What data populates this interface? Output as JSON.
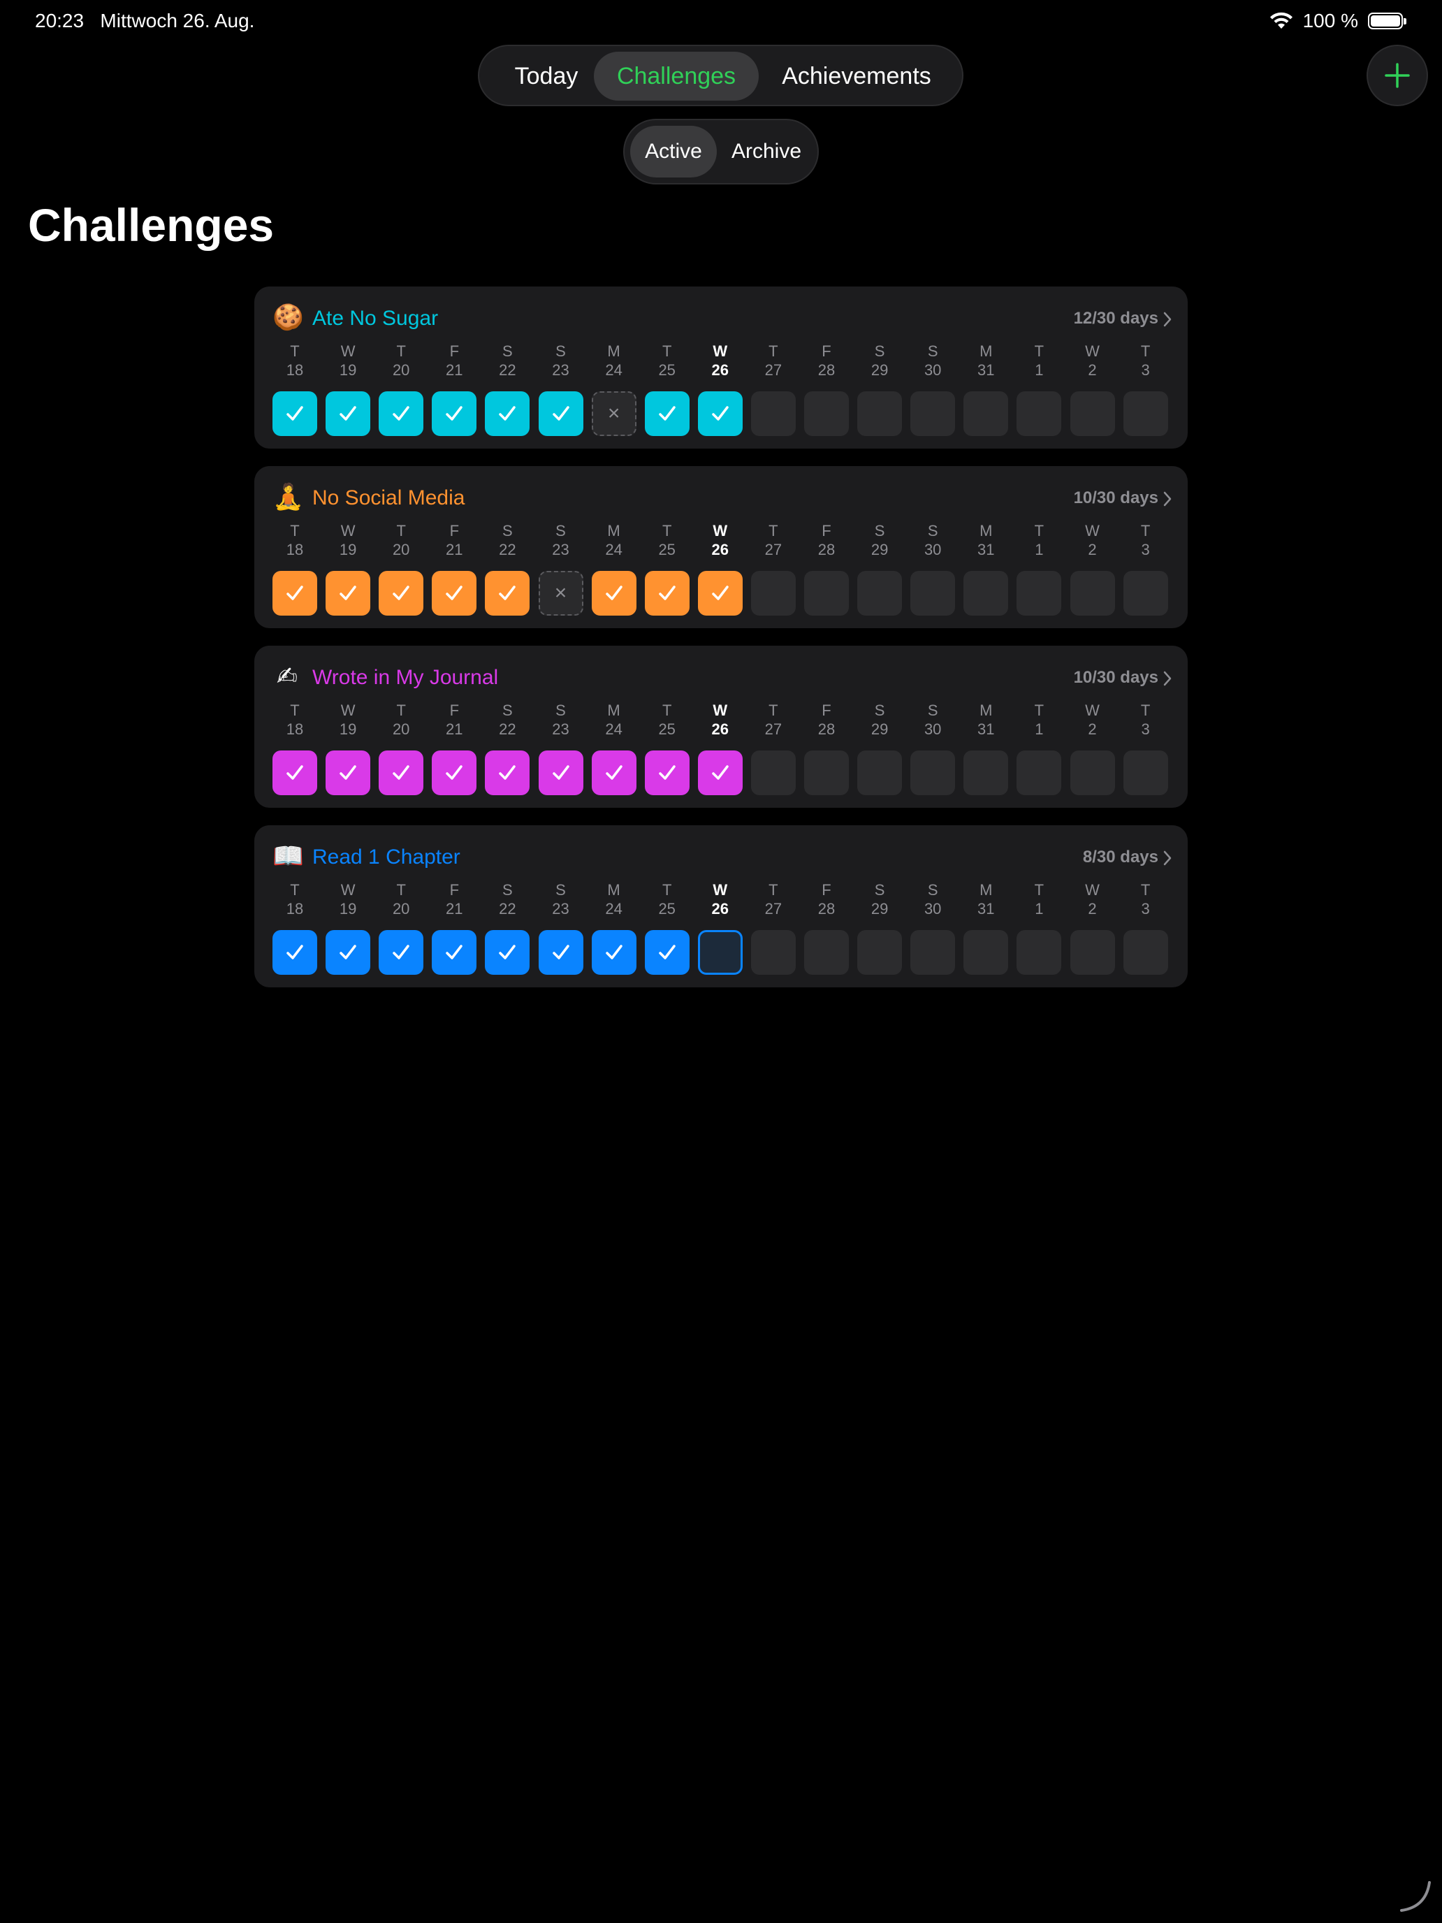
{
  "status": {
    "time": "20:23",
    "date": "Mittwoch 26. Aug.",
    "battery": "100 %"
  },
  "tabs": {
    "today": "Today",
    "challenges": "Challenges",
    "achievements": "Achievements",
    "selected": "Challenges"
  },
  "filter": {
    "active": "Active",
    "archive": "Archive",
    "selected": "Active"
  },
  "page_title": "Challenges",
  "colors": {
    "accent": "#30d158",
    "cyan": "#00c7de",
    "orange": "#ff9230",
    "magenta": "#d93ae8",
    "blue": "#0a84ff"
  },
  "days": [
    {
      "letter": "T",
      "num": "18"
    },
    {
      "letter": "W",
      "num": "19"
    },
    {
      "letter": "T",
      "num": "20"
    },
    {
      "letter": "F",
      "num": "21"
    },
    {
      "letter": "S",
      "num": "22"
    },
    {
      "letter": "S",
      "num": "23"
    },
    {
      "letter": "M",
      "num": "24"
    },
    {
      "letter": "T",
      "num": "25"
    },
    {
      "letter": "W",
      "num": "26"
    },
    {
      "letter": "T",
      "num": "27"
    },
    {
      "letter": "F",
      "num": "28"
    },
    {
      "letter": "S",
      "num": "29"
    },
    {
      "letter": "S",
      "num": "30"
    },
    {
      "letter": "M",
      "num": "31"
    },
    {
      "letter": "T",
      "num": "1"
    },
    {
      "letter": "W",
      "num": "2"
    },
    {
      "letter": "T",
      "num": "3"
    }
  ],
  "today_index": 8,
  "challenges": [
    {
      "emoji": "🍪",
      "emoji_name": "cookie-icon",
      "title": "Ate No Sugar",
      "progress": "12/30 days",
      "color": "#00c7de",
      "states": [
        "done",
        "done",
        "done",
        "done",
        "done",
        "done",
        "missed",
        "done",
        "done",
        "future",
        "future",
        "future",
        "future",
        "future",
        "future",
        "future",
        "future"
      ]
    },
    {
      "emoji": "🧘",
      "emoji_name": "meditation-icon",
      "title": "No Social Media",
      "progress": "10/30 days",
      "color": "#ff9230",
      "states": [
        "done",
        "done",
        "done",
        "done",
        "done",
        "missed",
        "done",
        "done",
        "done",
        "future",
        "future",
        "future",
        "future",
        "future",
        "future",
        "future",
        "future"
      ]
    },
    {
      "emoji": "✍",
      "emoji_name": "writing-hand-icon",
      "title": "Wrote in My Journal",
      "progress": "10/30 days",
      "color": "#d93ae8",
      "states": [
        "done",
        "done",
        "done",
        "done",
        "done",
        "done",
        "done",
        "done",
        "done",
        "future",
        "future",
        "future",
        "future",
        "future",
        "future",
        "future",
        "future"
      ]
    },
    {
      "emoji": "📖",
      "emoji_name": "book-icon",
      "title": "Read 1 Chapter",
      "progress": "8/30 days",
      "color": "#0a84ff",
      "states": [
        "done",
        "done",
        "done",
        "done",
        "done",
        "done",
        "done",
        "done",
        "pending",
        "future",
        "future",
        "future",
        "future",
        "future",
        "future",
        "future",
        "future"
      ]
    }
  ]
}
